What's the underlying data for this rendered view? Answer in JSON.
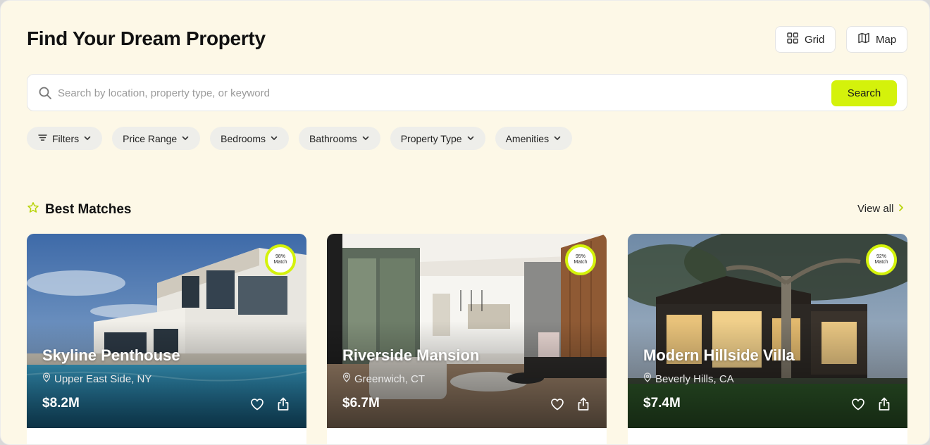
{
  "header": {
    "title": "Find Your Dream Property",
    "view_toggle": [
      {
        "label": "Grid",
        "icon": "grid-icon"
      },
      {
        "label": "Map",
        "icon": "map-icon"
      }
    ]
  },
  "search": {
    "placeholder": "Search by location, property type, or keyword",
    "value": "",
    "button_label": "Search"
  },
  "filters": [
    {
      "label": "Filters",
      "icon": "sliders-icon"
    },
    {
      "label": "Price Range"
    },
    {
      "label": "Bedrooms"
    },
    {
      "label": "Bathrooms"
    },
    {
      "label": "Property Type"
    },
    {
      "label": "Amenities"
    }
  ],
  "section": {
    "title": "Best Matches",
    "icon": "star-icon",
    "view_all_label": "View all"
  },
  "properties": [
    {
      "name": "Skyline Penthouse",
      "location": "Upper East Side, NY",
      "price": "$8.2M",
      "match_pct": "98%",
      "match_label": "Match"
    },
    {
      "name": "Riverside Mansion",
      "location": "Greenwich, CT",
      "price": "$6.7M",
      "match_pct": "95%",
      "match_label": "Match"
    },
    {
      "name": "Modern Hillside Villa",
      "location": "Beverly Hills, CA",
      "price": "$7.4M",
      "match_pct": "92%",
      "match_label": "Match"
    }
  ],
  "colors": {
    "accent": "#d4f20b",
    "background": "#fdf8e7",
    "chip": "#eeeeea"
  }
}
